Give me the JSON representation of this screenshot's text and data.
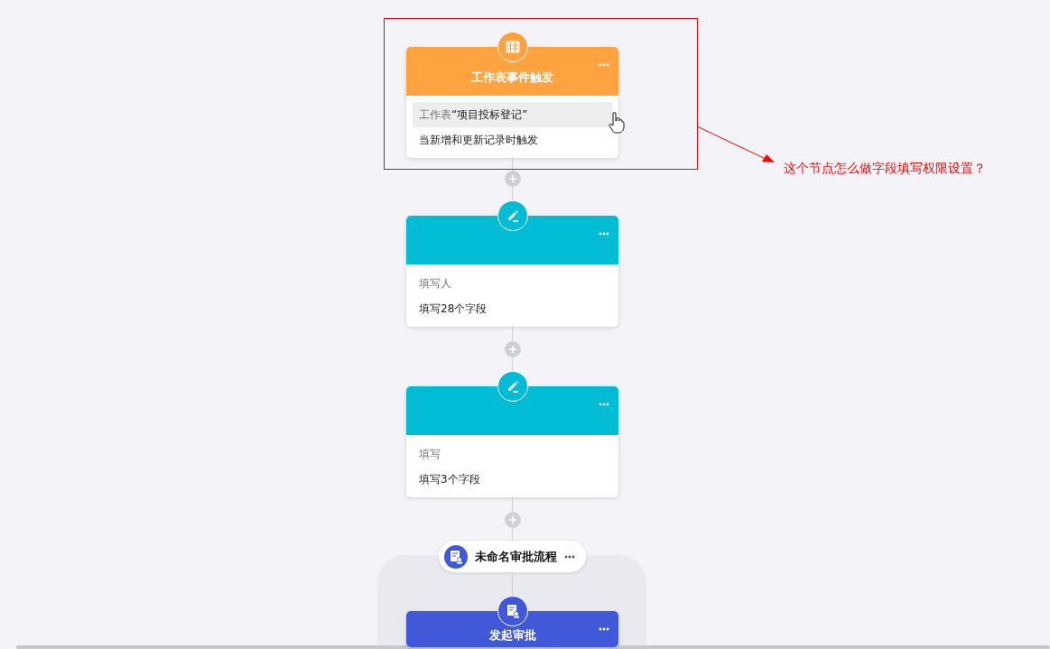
{
  "nodes": [
    {
      "kind": "trigger",
      "title": "工作表事件触发",
      "lines": [
        {
          "label": "工作表",
          "value": "“项目投标登记”",
          "highlighted": true
        },
        {
          "value": "当新增和更新记录时触发",
          "highlighted": false
        }
      ]
    },
    {
      "kind": "fill",
      "lines": [
        {
          "label": "填写人"
        },
        {
          "value": "填写28个字段"
        }
      ]
    },
    {
      "kind": "fill",
      "lines": [
        {
          "label": "填写"
        },
        {
          "value": "填写3个字段"
        }
      ]
    }
  ],
  "approval_group": {
    "title": "未命名审批流程",
    "node": {
      "kind": "approval",
      "title": "发起审批"
    }
  },
  "annotation": {
    "text": "这个节点怎么做字段填写权限设置？"
  }
}
